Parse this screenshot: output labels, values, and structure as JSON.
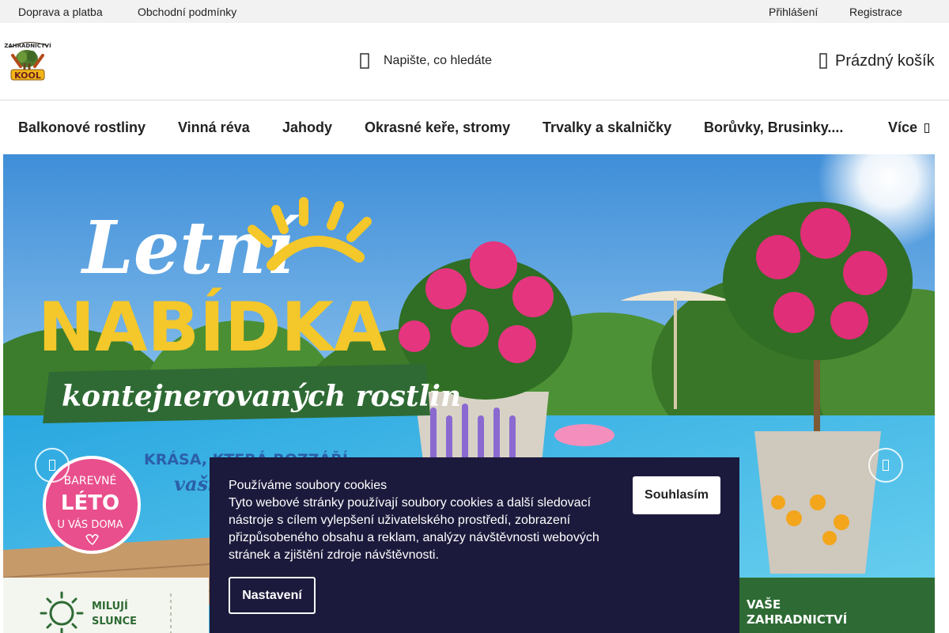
{
  "topbar": {
    "links": [
      "Doprava a platba",
      "Obchodní podmínky"
    ],
    "login": "Přihlášení",
    "register": "Registrace"
  },
  "header": {
    "logo_text_top": "ZAHRADNICTVÍ",
    "logo_text_bottom": "KOOL",
    "search_placeholder": "Napište, co hledáte",
    "cart_label": "Prázdný košík"
  },
  "nav": {
    "items": [
      "Balkonové rostliny",
      "Vinná réva",
      "Jahody",
      "Okrasné keře, stromy",
      "Trvalky a skalničky",
      "Borůvky, Brusinky....",
      "Více"
    ]
  },
  "hero": {
    "title_line1": "Letní",
    "title_line2": "NABÍDKA",
    "subtitle": "kontejnerovaných rostlin",
    "tagline_1": "KRÁSA, KTERÁ ROZZÁŘÍ",
    "tagline_2": "vaši",
    "badge_line1": "BAREVNÉ",
    "badge_line2": "LÉTO",
    "badge_line3": "U VÁS DOMA",
    "feature_1_line1": "MILUJÍ",
    "feature_1_line2": "SLUNCE",
    "feature_2_line1": "VAŠE",
    "feature_2_line2": "ZAHRADNICTVÍ"
  },
  "cookie": {
    "title": "Používáme soubory cookies",
    "text": "Tyto webové stránky používají soubory cookies a další sledovací nástroje s cílem vylepšení uživatelského prostředí, zobrazení přizpůsobeného obsahu a reklam, analýzy návštěvnosti webových stránek a zjištění zdroje návštěvnosti.",
    "agree_label": "Souhlasím",
    "settings_label": "Nastavení"
  },
  "colors": {
    "cookie_bg": "#1c1a3c",
    "topbar_bg": "#f2f2f2",
    "banner_green": "#2f6a34",
    "banner_yellow": "#f4c72a",
    "badge_pink": "#e94f8c"
  },
  "icons": {
    "search": "search-icon",
    "cart": "cart-icon",
    "more": "chevron-down-icon",
    "prev": "chevron-left-icon",
    "next": "chevron-right-icon"
  }
}
